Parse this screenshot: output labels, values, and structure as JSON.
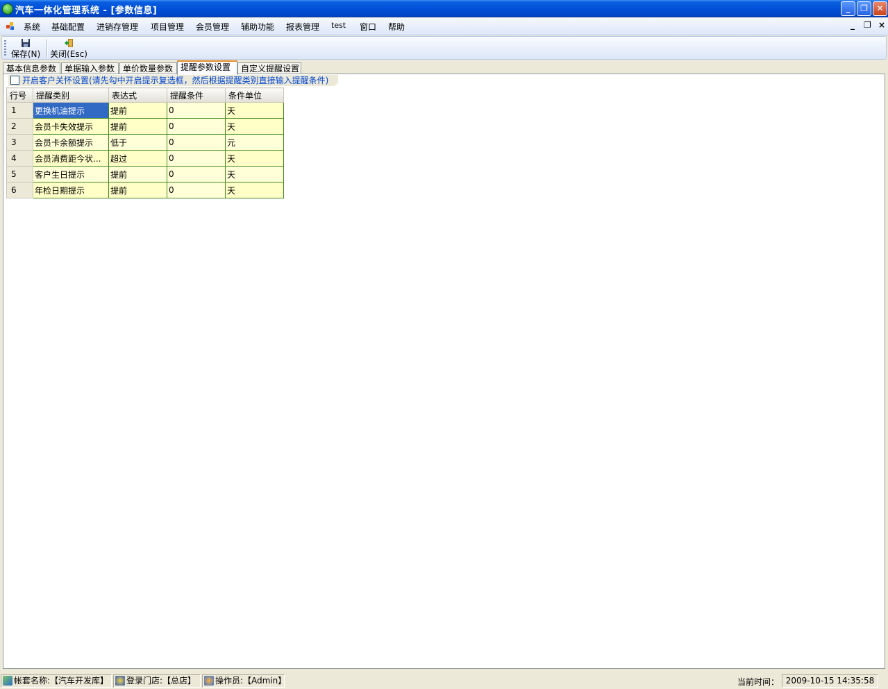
{
  "window": {
    "title": "汽车一体化管理系统 - [参数信息]",
    "minimize": "_",
    "restore": "❐",
    "close": "✕"
  },
  "menu": {
    "items": [
      "系统",
      "基础配置",
      "进销存管理",
      "项目管理",
      "会员管理",
      "辅助功能",
      "报表管理",
      "test",
      "窗口",
      "帮助"
    ],
    "mdi_minimize": "_",
    "mdi_restore": "❐",
    "mdi_close": "×"
  },
  "toolbar": {
    "save_label": "保存(N)",
    "close_label": "关闭(Esc)"
  },
  "tabs": [
    "基本信息参数",
    "单据输入参数",
    "单价数量参数",
    "提醒参数设置",
    "自定义提醒设置"
  ],
  "active_tab": 3,
  "care_option": {
    "label": "开启客户关怀设置(请先勾中开启提示复选框，然后根据提醒类别直接输入提醒条件)",
    "checked": false
  },
  "grid": {
    "columns": [
      "行号",
      "提醒类别",
      "表达式",
      "提醒条件",
      "条件单位"
    ],
    "rows": [
      {
        "no": "1",
        "type": "更换机油提示",
        "expr": "提前",
        "cond": "0",
        "unit": "天"
      },
      {
        "no": "2",
        "type": "会员卡失效提示",
        "expr": "提前",
        "cond": "0",
        "unit": "天"
      },
      {
        "no": "3",
        "type": "会员卡余额提示",
        "expr": "低于",
        "cond": "0",
        "unit": "元"
      },
      {
        "no": "4",
        "type": "会员消费距今状...",
        "expr": "超过",
        "cond": "0",
        "unit": "天"
      },
      {
        "no": "5",
        "type": "客户生日提示",
        "expr": "提前",
        "cond": "0",
        "unit": "天"
      },
      {
        "no": "6",
        "type": "年检日期提示",
        "expr": "提前",
        "cond": "0",
        "unit": "天"
      }
    ]
  },
  "status": {
    "account": "帐套名称:【汽车开发库】",
    "store": "登录门店:【总店】",
    "operator": "操作员:【Admin】",
    "time_label": "当前时间：",
    "time_value": "2009-10-15 14:35:58"
  },
  "colors": {
    "titlebar": "#0050d8",
    "selected_cell": "#316ac5",
    "grid_border": "#3e8a1c",
    "cell_bg": "#ffffd8",
    "active_tab_accent": "#e68b2c"
  }
}
